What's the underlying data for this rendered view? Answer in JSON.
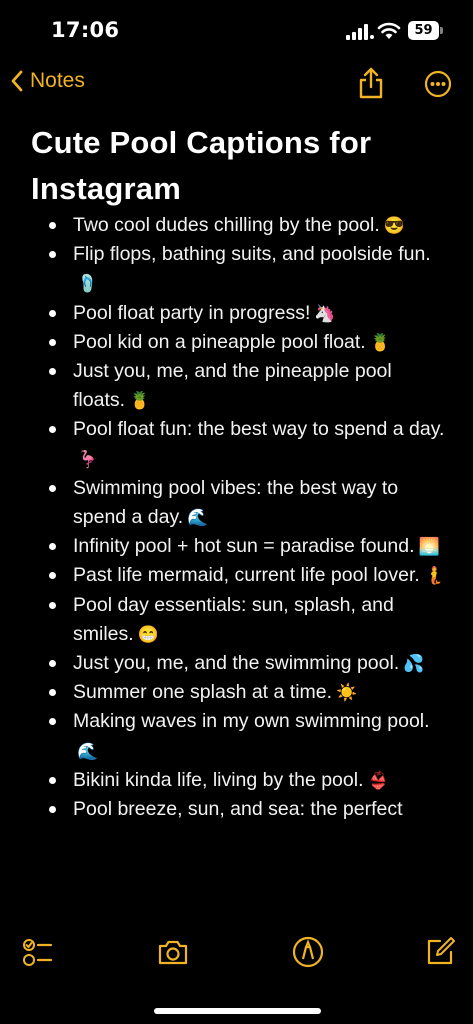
{
  "status_bar": {
    "time": "17:06",
    "battery": "59"
  },
  "nav": {
    "back_label": "Notes"
  },
  "note": {
    "title": "Cute Pool Captions for Instagram",
    "items": [
      {
        "text": "Two cool dudes chilling by the pool.",
        "emoji": "😎"
      },
      {
        "text": "Flip flops, bathing suits, and poolside fun.",
        "emoji": "🩴"
      },
      {
        "text": "Pool float party in progress!",
        "emoji": "🦄"
      },
      {
        "text": "Pool kid on a pineapple pool float.",
        "emoji": "🍍"
      },
      {
        "text": "Just you, me, and the pineapple pool floats.",
        "emoji": "🍍"
      },
      {
        "text": "Pool float fun: the best way to spend a day.",
        "emoji": "🦩"
      },
      {
        "text": "Swimming pool vibes: the best way to spend a day.",
        "emoji": "🌊"
      },
      {
        "text": "Infinity pool + hot sun = paradise found.",
        "emoji": "🌅"
      },
      {
        "text": "Past life mermaid, current life pool lover.",
        "emoji": "🧜"
      },
      {
        "text": "Pool day essentials: sun, splash, and smiles.",
        "emoji": "😁"
      },
      {
        "text": "Just you, me, and the swimming pool.",
        "emoji": "💦"
      },
      {
        "text": "Summer one splash at a time.",
        "emoji": "☀️"
      },
      {
        "text": "Making waves in my own swimming pool.",
        "emoji": "🌊"
      },
      {
        "text": "Bikini kinda life, living by the pool.",
        "emoji": "👙"
      },
      {
        "text": "Pool breeze, sun, and sea: the perfect",
        "emoji": ""
      }
    ]
  },
  "icons": {
    "accent": "#f0b324",
    "nav": [
      "chevron-left-icon",
      "share-icon",
      "more-icon"
    ],
    "toolbar": [
      "checklist-icon",
      "camera-icon",
      "markup-icon",
      "compose-icon"
    ]
  }
}
